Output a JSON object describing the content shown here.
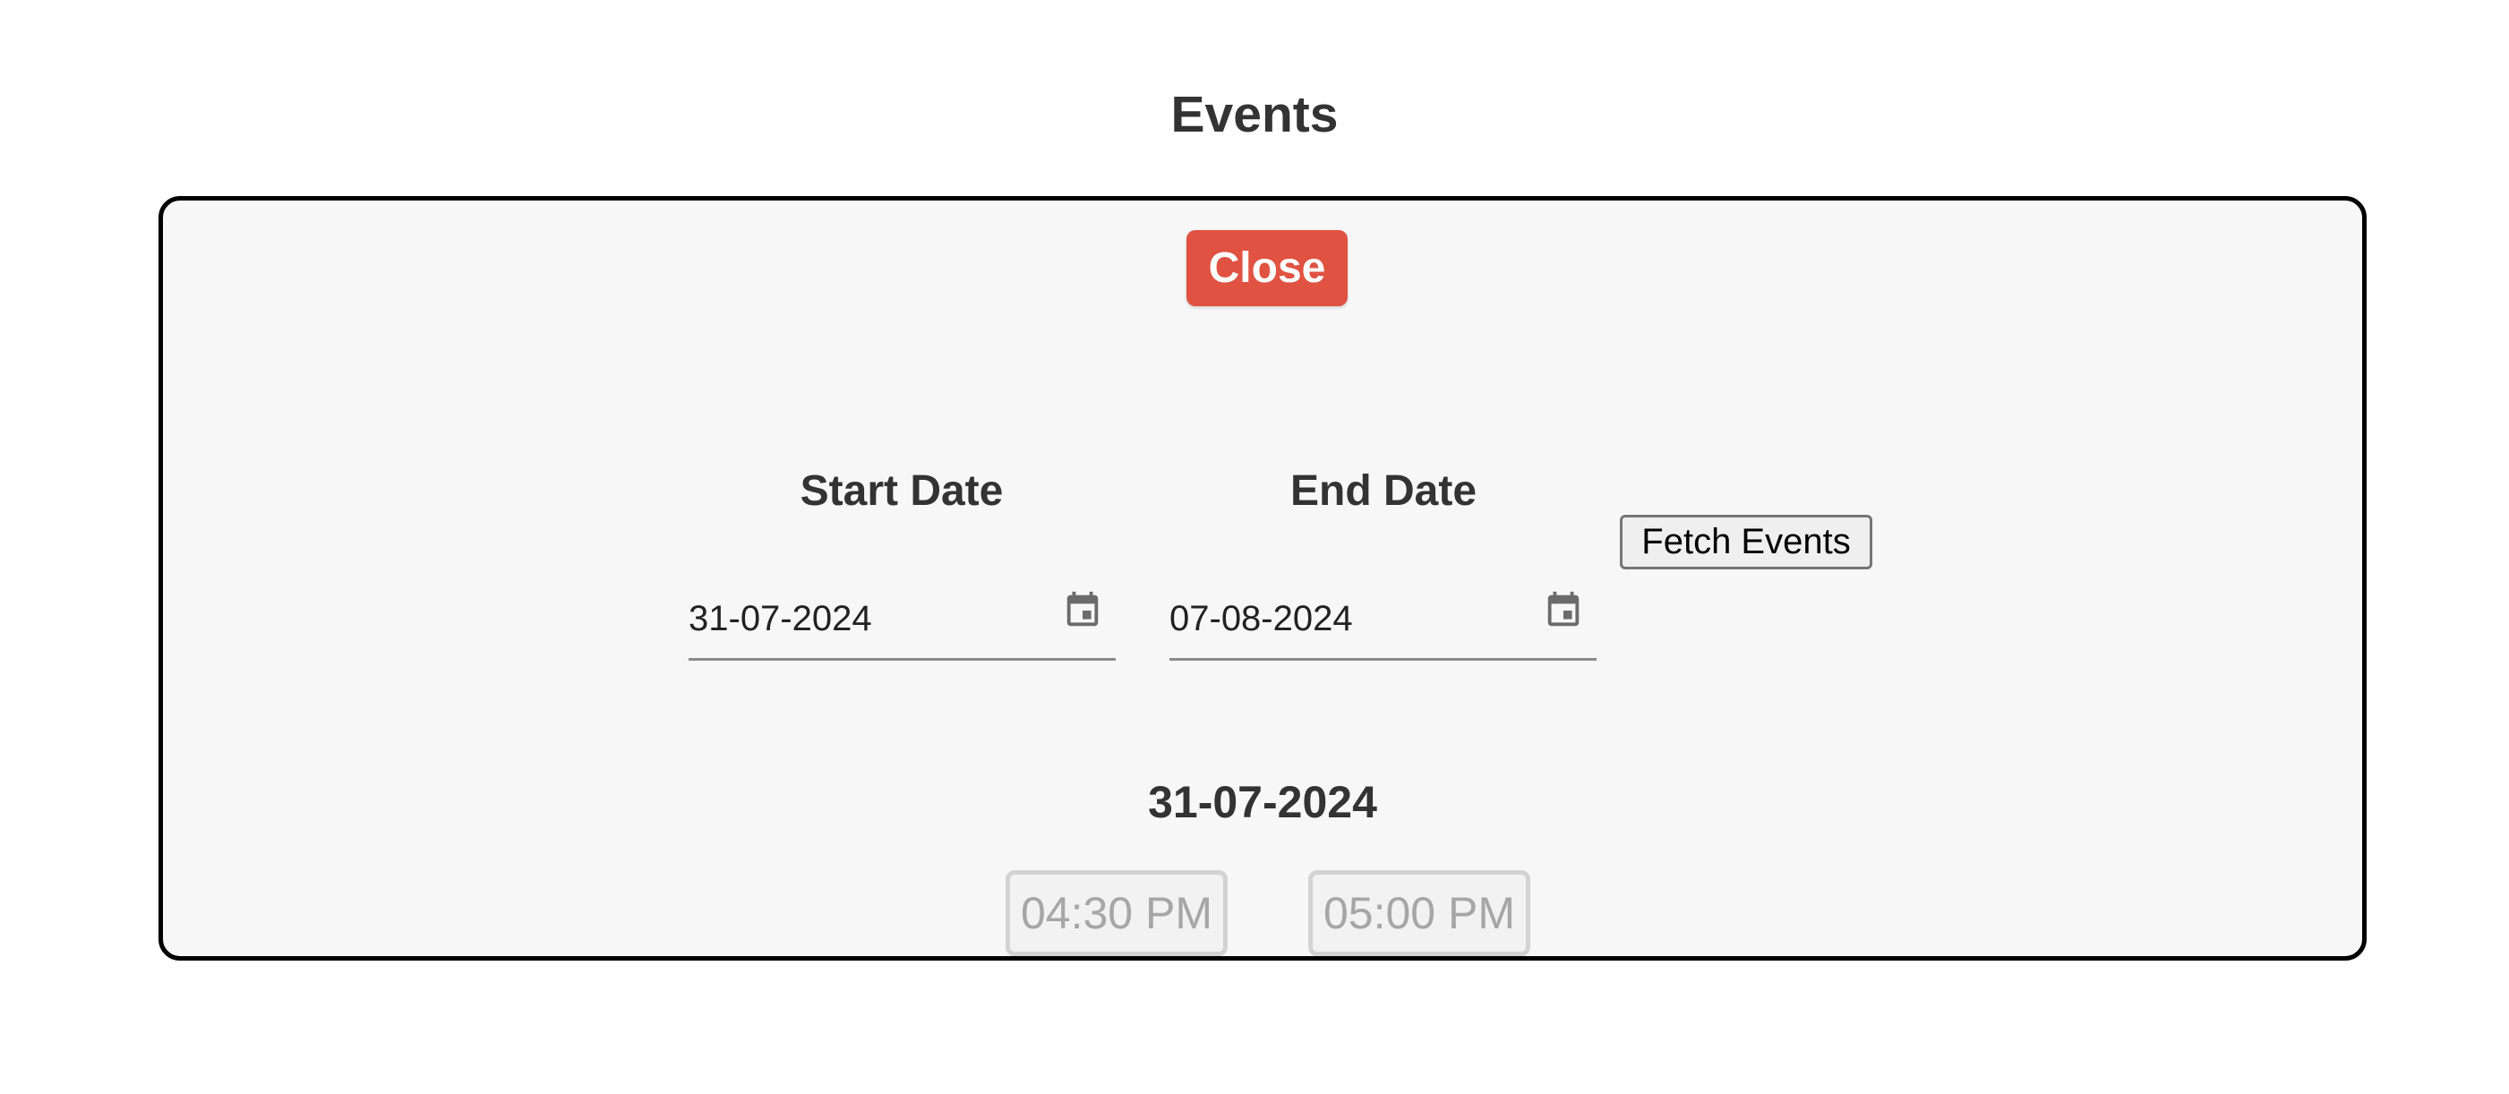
{
  "page": {
    "title": "Events"
  },
  "panel": {
    "close_label": "Close",
    "start_date": {
      "label": "Start Date",
      "value": "31-07-2024",
      "icon": "calendar-icon"
    },
    "end_date": {
      "label": "End Date",
      "value": "07-08-2024",
      "icon": "calendar-icon"
    },
    "fetch_label": "Fetch Events",
    "day": {
      "heading": "31-07-2024",
      "slots": [
        "04:30 PM",
        "05:00 PM"
      ]
    }
  },
  "colors": {
    "close_button": "#e05241",
    "panel_background": "#f7f7f7",
    "panel_border": "#000000",
    "slot_text_disabled": "#a6a6a6"
  }
}
